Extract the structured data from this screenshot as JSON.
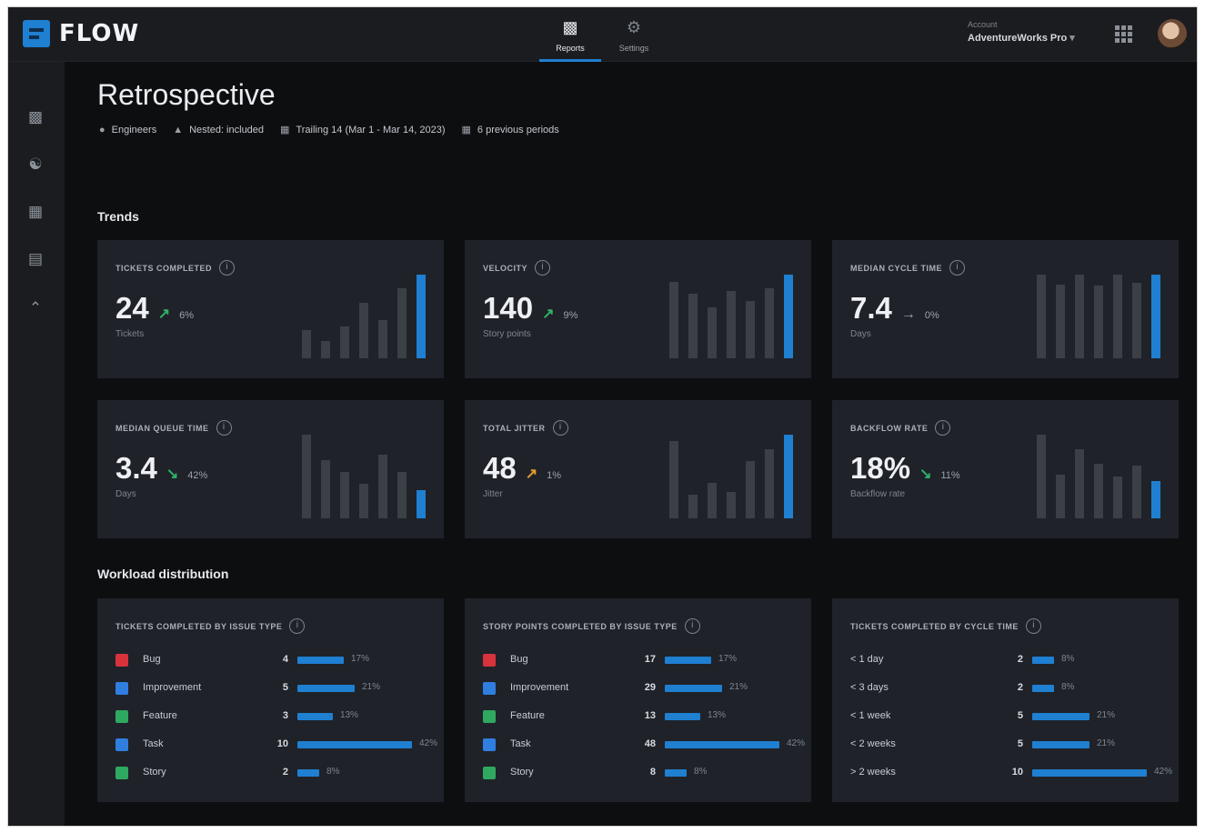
{
  "app": {
    "name": "FLOW",
    "nav": [
      {
        "label": "Reports",
        "icon": "bar-chart-icon",
        "active": true
      },
      {
        "label": "Settings",
        "icon": "gear-icon",
        "active": false
      }
    ],
    "account": {
      "label": "Account",
      "value": "AdventureWorks Pro"
    }
  },
  "page": {
    "title": "Retrospective",
    "filters": [
      {
        "icon": "person-icon",
        "label": "Engineers"
      },
      {
        "icon": "tree-icon",
        "label": "Nested: included"
      },
      {
        "icon": "calendar-icon",
        "label": "Trailing 14 (Mar 1 - Mar 14, 2023)"
      },
      {
        "icon": "calendar-icon",
        "label": "6 previous periods"
      }
    ]
  },
  "trends": {
    "title": "Trends",
    "cards": [
      {
        "label": "TICKETS COMPLETED",
        "value": "24",
        "trend": "up",
        "trend_color": "#2fb36a",
        "change": "6%",
        "unit": "Tickets",
        "history": [
          8,
          5,
          9,
          16,
          11,
          20,
          24
        ]
      },
      {
        "label": "VELOCITY",
        "value": "140",
        "trend": "up",
        "trend_color": "#2fb36a",
        "change": "9%",
        "unit": "Story points",
        "history": [
          128,
          108,
          85,
          112,
          96,
          117,
          140
        ]
      },
      {
        "label": "MEDIAN CYCLE TIME",
        "value": "7.4",
        "trend": "flat",
        "trend_color": "#a0a6ae",
        "change": "0%",
        "unit": "Days",
        "history": [
          7.4,
          6.5,
          7.4,
          6.4,
          7.4,
          6.7,
          7.4
        ]
      },
      {
        "label": "MEDIAN QUEUE TIME",
        "value": "3.4",
        "trend": "down",
        "trend_color": "#2fb36a",
        "change": "42%",
        "unit": "Days",
        "history": [
          10.2,
          7.1,
          5.6,
          4.2,
          7.8,
          5.6,
          3.4
        ]
      },
      {
        "label": "TOTAL JITTER",
        "value": "48",
        "trend": "up",
        "trend_color": "#e89a2c",
        "change": "1%",
        "unit": "Jitter",
        "history": [
          65,
          20,
          30,
          22,
          48,
          58,
          70
        ]
      },
      {
        "label": "BACKFLOW RATE",
        "value": "18%",
        "trend": "down",
        "trend_color": "#2fb36a",
        "change": "11%",
        "unit": "Backflow rate",
        "history": [
          40,
          21,
          33,
          26,
          20,
          25,
          18
        ]
      }
    ]
  },
  "workload": {
    "title": "Workload distribution",
    "cards": [
      {
        "label": "TICKETS COMPLETED BY ISSUE TYPE",
        "rows": [
          {
            "label": "Bug",
            "badge_color": "#d8333b",
            "count": "4",
            "pct": "17%",
            "share": 0.17
          },
          {
            "label": "Improvement",
            "badge_color": "#2f7ee0",
            "count": "5",
            "pct": "21%",
            "share": 0.21
          },
          {
            "label": "Feature",
            "badge_color": "#2fa860",
            "count": "3",
            "pct": "13%",
            "share": 0.13
          },
          {
            "label": "Task",
            "badge_color": "#2f7ee0",
            "count": "10",
            "pct": "42%",
            "share": 0.42
          },
          {
            "label": "Story",
            "badge_color": "#2fa860",
            "count": "2",
            "pct": "8%",
            "share": 0.08
          }
        ]
      },
      {
        "label": "STORY POINTS COMPLETED BY ISSUE TYPE",
        "rows": [
          {
            "label": "Bug",
            "badge_color": "#d8333b",
            "count": "17",
            "pct": "17%",
            "share": 0.17
          },
          {
            "label": "Improvement",
            "badge_color": "#2f7ee0",
            "count": "29",
            "pct": "21%",
            "share": 0.21
          },
          {
            "label": "Feature",
            "badge_color": "#2fa860",
            "count": "13",
            "pct": "13%",
            "share": 0.13
          },
          {
            "label": "Task",
            "badge_color": "#2f7ee0",
            "count": "48",
            "pct": "42%",
            "share": 0.42
          },
          {
            "label": "Story",
            "badge_color": "#2fa860",
            "count": "8",
            "pct": "8%",
            "share": 0.08
          }
        ]
      },
      {
        "label": "TICKETS COMPLETED BY CYCLE TIME",
        "rows": [
          {
            "label": "< 1 day",
            "badge_color": "",
            "count": "2",
            "pct": "8%",
            "share": 0.08
          },
          {
            "label": "< 3 days",
            "badge_color": "",
            "count": "2",
            "pct": "8%",
            "share": 0.08
          },
          {
            "label": "< 1 week",
            "badge_color": "",
            "count": "5",
            "pct": "21%",
            "share": 0.21
          },
          {
            "label": "< 2 weeks",
            "badge_color": "",
            "count": "5",
            "pct": "21%",
            "share": 0.21
          },
          {
            "label": "> 2 weeks",
            "badge_color": "",
            "count": "10",
            "pct": "42%",
            "share": 0.42
          }
        ]
      }
    ]
  }
}
